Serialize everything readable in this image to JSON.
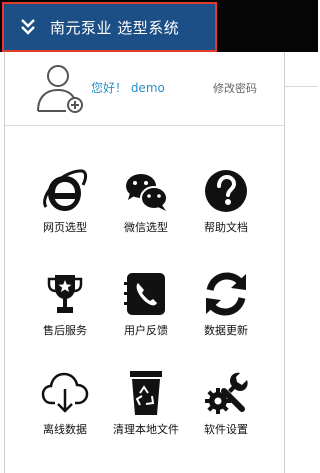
{
  "app": {
    "title": "南元泵业 选型系统"
  },
  "user": {
    "greeting": "您好！ demo",
    "change_password": "修改密码"
  },
  "menu": {
    "items": [
      {
        "label": "网页选型",
        "icon": "ie-browser-icon"
      },
      {
        "label": "微信选型",
        "icon": "wechat-icon"
      },
      {
        "label": "帮助文档",
        "icon": "help-question-icon"
      },
      {
        "label": "售后服务",
        "icon": "trophy-icon"
      },
      {
        "label": "用户反馈",
        "icon": "phone-contact-icon"
      },
      {
        "label": "数据更新",
        "icon": "refresh-icon"
      },
      {
        "label": "离线数据",
        "icon": "cloud-download-icon"
      },
      {
        "label": "清理本地文件",
        "icon": "recycle-bin-icon"
      },
      {
        "label": "软件设置",
        "icon": "settings-tools-icon"
      }
    ]
  },
  "colors": {
    "title_bg": "#1c4f86",
    "title_border": "#e23b2c",
    "greeting": "#2a8fc8",
    "topbar": "#050505"
  }
}
